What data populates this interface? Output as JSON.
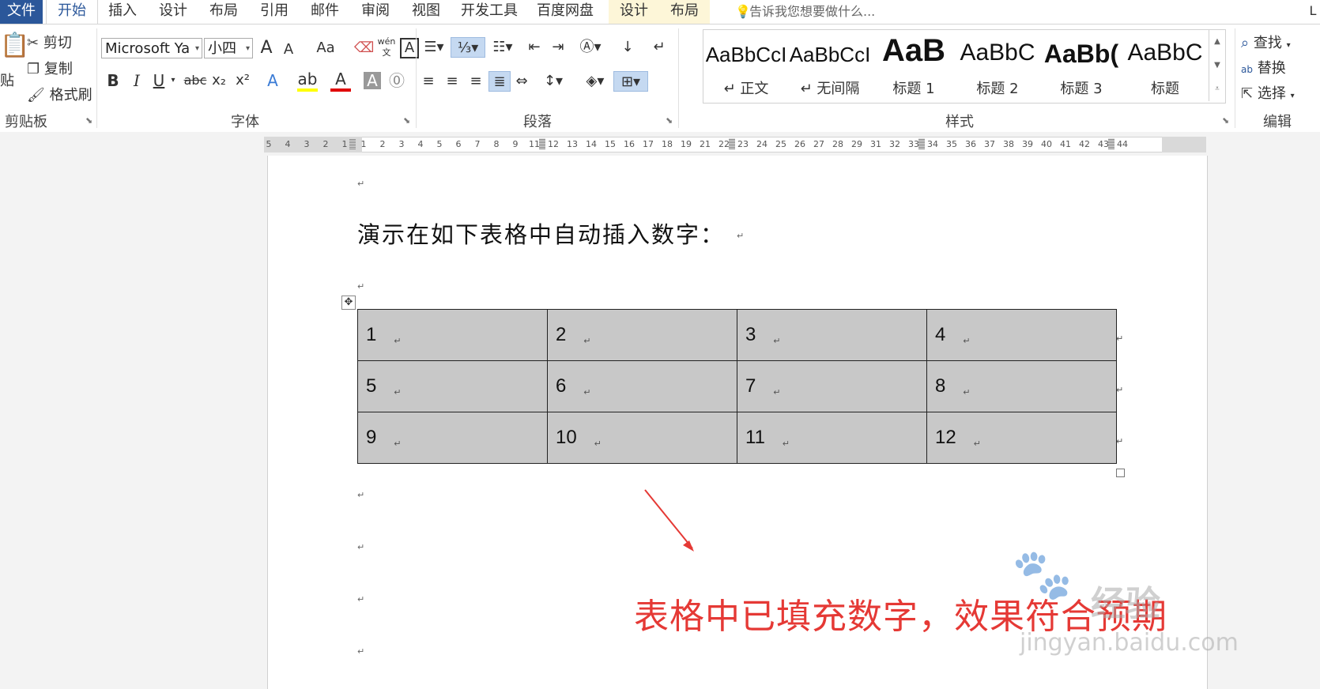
{
  "tabs": {
    "file": "文件",
    "home": "开始",
    "insert": "插入",
    "design": "设计",
    "layout": "布局",
    "references": "引用",
    "mailings": "邮件",
    "review": "审阅",
    "view": "视图",
    "developer": "开发工具",
    "baidu": "百度网盘",
    "table_design": "设计",
    "table_layout": "布局",
    "tell_me": "告诉我您想要做什么...",
    "user_initial": "L"
  },
  "clipboard": {
    "paste": "贴",
    "cut": "剪切",
    "copy": "复制",
    "format_painter": "格式刷",
    "label": "剪贴板"
  },
  "font": {
    "name": "Microsoft Ya",
    "size": "小四",
    "grow": "A",
    "shrink": "A",
    "change_case": "Aa",
    "bold": "B",
    "italic": "I",
    "underline": "U",
    "strike": "abc",
    "subscript": "x₂",
    "superscript": "x²",
    "phonetic": "wén",
    "label": "字体"
  },
  "paragraph": {
    "label": "段落"
  },
  "styles": {
    "label": "样式",
    "items": [
      {
        "sample": "AaBbCcI",
        "name": "↵ 正文"
      },
      {
        "sample": "AaBbCcI",
        "name": "↵ 无间隔"
      },
      {
        "sample": "AaB",
        "name": "标题 1"
      },
      {
        "sample": "AaBbC",
        "name": "标题 2"
      },
      {
        "sample": "AaBb(",
        "name": "标题 3"
      },
      {
        "sample": "AaBbC",
        "name": "标题"
      }
    ]
  },
  "editing": {
    "find": "查找",
    "replace": "替换",
    "select": "选择",
    "label": "编辑"
  },
  "ruler": {
    "numbers": [
      "5",
      "4",
      "3",
      "2",
      "1",
      "1",
      "2",
      "3",
      "4",
      "5",
      "6",
      "7",
      "8",
      "9",
      "11",
      "12",
      "13",
      "14",
      "15",
      "16",
      "17",
      "18",
      "19",
      "21",
      "22",
      "23",
      "24",
      "25",
      "26",
      "27",
      "28",
      "29",
      "31",
      "32",
      "33",
      "34",
      "35",
      "36",
      "37",
      "38",
      "39",
      "40",
      "41",
      "42",
      "43",
      "44"
    ]
  },
  "document": {
    "heading": "演示在如下表格中自动插入数字：",
    "table": [
      [
        "1",
        "2",
        "3",
        "4"
      ],
      [
        "5",
        "6",
        "7",
        "8"
      ],
      [
        "9",
        "10",
        "11",
        "12"
      ]
    ],
    "para_mark": "↵"
  },
  "annotation": {
    "text": "表格中已填充数字，效果符合预期",
    "color": "#e53935"
  },
  "watermark": {
    "logo": "🐾",
    "text": "经验",
    "url": "jingyan.baidu.com"
  },
  "colors": {
    "accent": "#2b579a",
    "table_fill": "#c8c8c8",
    "highlight": "#ffff00",
    "font_color": "#e00000"
  }
}
